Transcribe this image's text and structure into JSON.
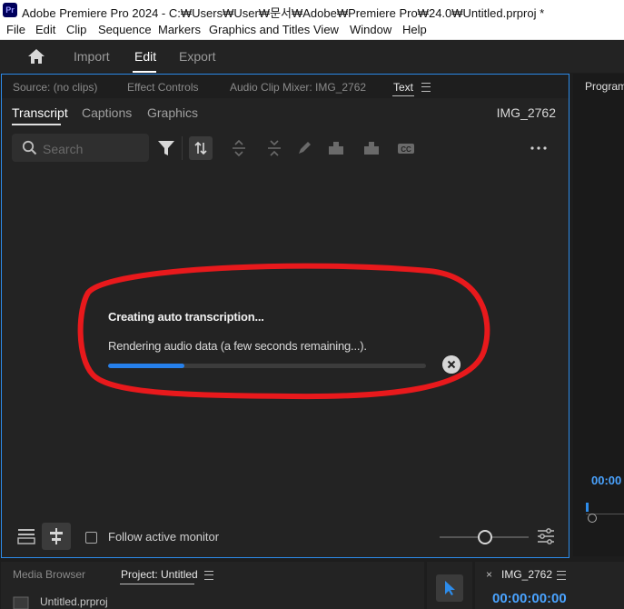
{
  "titlebar": {
    "logo_text": "Pr",
    "title": "Adobe Premiere Pro 2024 - C:₩Users₩User₩문서₩Adobe₩Premiere Pro₩24.0₩Untitled.prproj *"
  },
  "menu": {
    "items": [
      "File",
      "Edit",
      "Clip",
      "Sequence",
      "Markers",
      "Graphics and Titles",
      "View",
      "Window",
      "Help"
    ]
  },
  "workspace": {
    "tabs": [
      "Import",
      "Edit",
      "Export"
    ],
    "active": "Edit"
  },
  "panel_tabs": {
    "source": "Source: (no clips)",
    "effect_controls": "Effect Controls",
    "audio_mixer": "Audio Clip Mixer: IMG_2762",
    "text": "Text"
  },
  "text_panel": {
    "subtabs": [
      "Transcript",
      "Captions",
      "Graphics"
    ],
    "clip_name": "IMG_2762",
    "search_placeholder": "Search",
    "progress": {
      "title": "Creating auto transcription...",
      "message": "Rendering audio data (a few seconds remaining...).",
      "fraction": 0.24
    },
    "follow_label": "Follow active monitor",
    "annotation_color": "#e8191c",
    "accent_color": "#2680eb"
  },
  "program": {
    "tab_label": "Program",
    "timecode": "00:00"
  },
  "bottom": {
    "media_browser": "Media Browser",
    "project_tab": "Project: Untitled",
    "project_file": "Untitled.prproj",
    "timeline_tab": "IMG_2762",
    "timeline_close": "×",
    "timeline_timecode": "00:00:00:00"
  }
}
